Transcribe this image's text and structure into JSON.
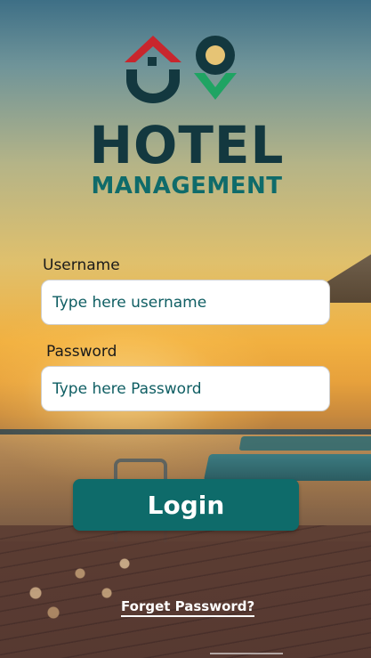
{
  "brand": {
    "title": "HOTEL",
    "subtitle": "MANAGEMENT",
    "colors": {
      "dark": "#13383f",
      "teal": "#0f6b6a",
      "red": "#c8262d",
      "green": "#1fa463"
    }
  },
  "login_form": {
    "username_label": "Username",
    "username_placeholder": "Type here username",
    "username_value": "",
    "password_label": "Password",
    "password_placeholder": "Type here Password",
    "password_value": "",
    "login_label": "Login",
    "forgot_label": "Forget Password?"
  },
  "theme": {
    "button_color": "#0e6b6a"
  }
}
